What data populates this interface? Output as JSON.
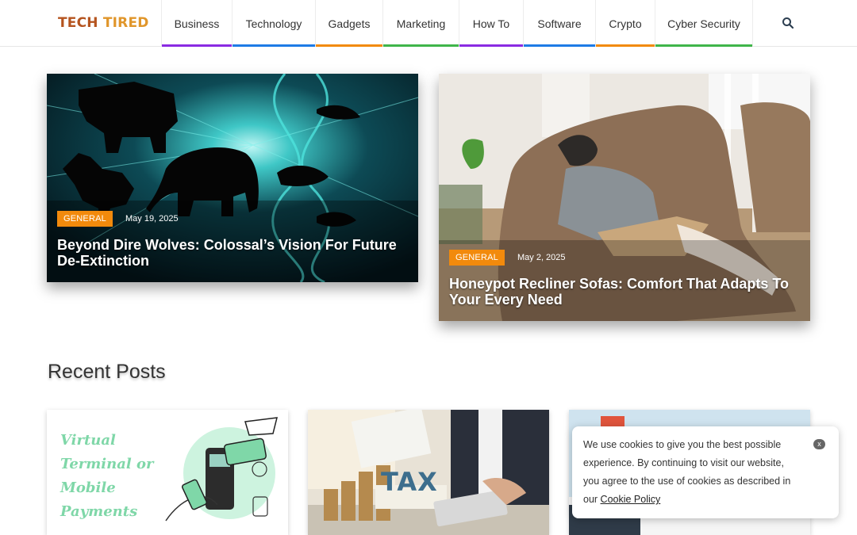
{
  "brand": {
    "part1": "TECH",
    "part2": "TIRED"
  },
  "nav": [
    {
      "label": "Business",
      "color": "#8a2be2"
    },
    {
      "label": "Technology",
      "color": "#1e7be6"
    },
    {
      "label": "Gadgets",
      "color": "#f28a0c"
    },
    {
      "label": "Marketing",
      "color": "#3fb54a"
    },
    {
      "label": "How To",
      "color": "#8a2be2"
    },
    {
      "label": "Software",
      "color": "#1e7be6"
    },
    {
      "label": "Crypto",
      "color": "#f28a0c"
    },
    {
      "label": "Cyber Security",
      "color": "#3fb54a"
    }
  ],
  "search_icon": "search-icon",
  "featured": [
    {
      "category": "GENERAL",
      "date": "May 19, 2025",
      "title": "Beyond Dire Wolves: Colossal’s Vision For Future De-Extinction"
    },
    {
      "category": "GENERAL",
      "date": "May 2, 2025",
      "title": "Honeypot Recliner Sofas: Comfort That Adapts To Your Every Need"
    }
  ],
  "recent": {
    "heading": "Recent Posts",
    "posts": [
      {
        "image_text_lines": [
          "Virtual",
          "Terminal or",
          "Mobile",
          "Payments"
        ]
      },
      {
        "image_text": "TAX"
      },
      {
        "image_text": ""
      }
    ]
  },
  "cookie": {
    "message": "We use cookies to give you the best possible experience. By continuing to visit our website, you agree to the use of cookies as described in our ",
    "link": "Cookie Policy",
    "close": "x"
  },
  "colors": {
    "accent": "#f28a0c",
    "brand_dark": "#b5541f",
    "brand_light": "#e0962b"
  }
}
